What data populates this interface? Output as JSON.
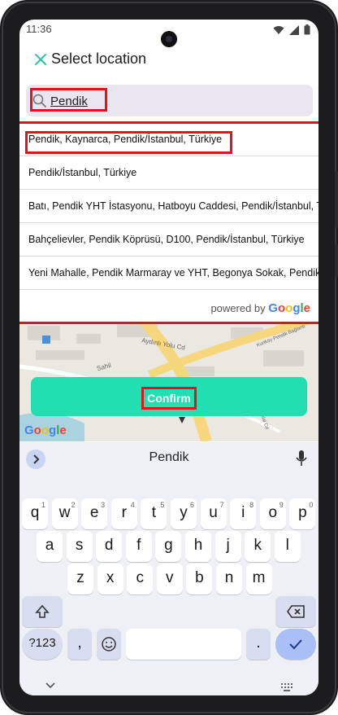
{
  "status_bar": {
    "time": "11:36"
  },
  "header": {
    "title": "Select location"
  },
  "search": {
    "value": "Pendik"
  },
  "suggestions": [
    "Pendik, Kaynarca, Pendik/İstanbul, Türkiye",
    "Pendik/İstanbul, Türkiye",
    "Batı, Pendik YHT İstasyonu, Hatboyu Caddesi, Pendik/İstanbul, T",
    "Bahçelievler, Pendik Köprüsü, D100, Pendik/İstanbul, Türkiye",
    "Yeni Mahalle, Pendik Marmaray ve YHT, Begonya Sokak, Pendik/"
  ],
  "powered_by": {
    "prefix": "powered by",
    "brand": "Google"
  },
  "map": {
    "labels": [
      "Aydınlı Yolu Cd",
      "Kurtköy Pendik Bağlantı",
      "Sahil",
      "İstiklal Cd"
    ],
    "logo": "Google"
  },
  "confirm": {
    "label": "Confirm"
  },
  "keyboard": {
    "suggestion": "Pendik",
    "row1": [
      "q",
      "w",
      "e",
      "r",
      "t",
      "y",
      "u",
      "i",
      "o",
      "p"
    ],
    "row1_hints": [
      "1",
      "2",
      "3",
      "4",
      "5",
      "6",
      "7",
      "8",
      "9",
      "0"
    ],
    "row2": [
      "a",
      "s",
      "d",
      "f",
      "g",
      "h",
      "j",
      "k",
      "l"
    ],
    "row3": [
      "z",
      "x",
      "c",
      "v",
      "b",
      "n",
      "m"
    ],
    "num_key": "?123",
    "comma": ",",
    "period": "."
  },
  "colors": {
    "accent": "#22dfb1",
    "highlight": "#e0131f",
    "close_icon": "#2ec4a0"
  }
}
